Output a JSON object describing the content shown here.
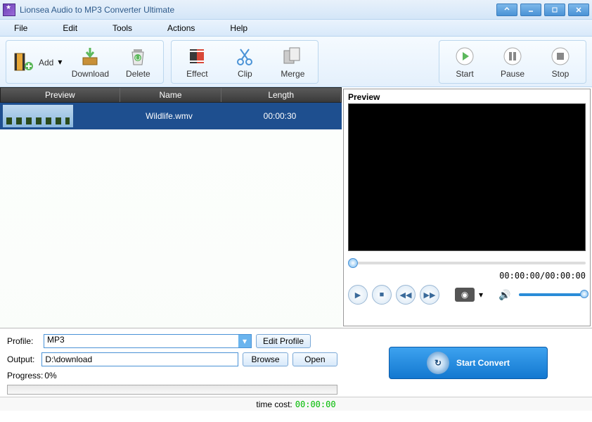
{
  "window": {
    "title": "Lionsea Audio to MP3 Converter Ultimate"
  },
  "menu": {
    "file": "File",
    "edit": "Edit",
    "tools": "Tools",
    "actions": "Actions",
    "help": "Help"
  },
  "toolbar": {
    "add": "Add",
    "download": "Download",
    "delete": "Delete",
    "effect": "Effect",
    "clip": "Clip",
    "merge": "Merge",
    "start": "Start",
    "pause": "Pause",
    "stop": "Stop"
  },
  "list": {
    "headers": {
      "preview": "Preview",
      "name": "Name",
      "length": "Length"
    },
    "rows": [
      {
        "name": "Wildlife.wmv",
        "length": "00:00:30"
      }
    ]
  },
  "preview": {
    "title": "Preview",
    "timecode": "00:00:00/00:00:00"
  },
  "output": {
    "profile_label": "Profile:",
    "profile_value": "MP3",
    "edit_profile": "Edit Profile",
    "output_label": "Output:",
    "output_value": "D:\\download",
    "browse": "Browse",
    "open": "Open",
    "progress_label": "Progress:",
    "progress_value": "0%"
  },
  "convert": {
    "label": "Start Convert"
  },
  "status": {
    "timecost_label": "time cost:",
    "timecost_value": "00:00:00"
  }
}
